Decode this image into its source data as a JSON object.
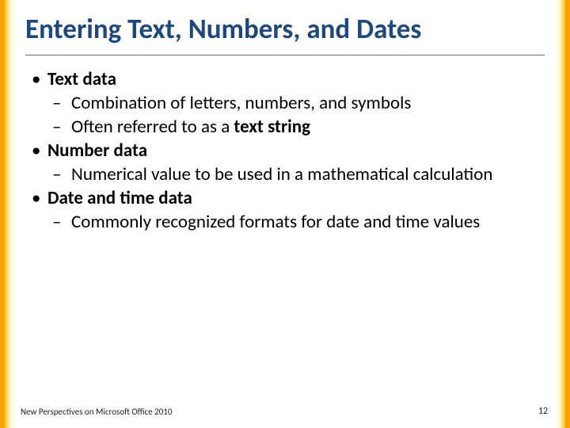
{
  "title": "Entering Text, Numbers, and Dates",
  "bullets": {
    "b1": {
      "label": "Text data"
    },
    "b1s1": "Combination of letters, numbers, and symbols",
    "b1s2_pre": "Often referred to as a ",
    "b1s2_bold": "text string",
    "b2": {
      "label": "Number data"
    },
    "b2s1": "Numerical value to be used in a mathematical calculation",
    "b3": {
      "label": "Date and time data"
    },
    "b3s1": "Commonly recognized formats for date and time values"
  },
  "footer": {
    "left": "New Perspectives on Microsoft Office 2010",
    "page": "12"
  }
}
